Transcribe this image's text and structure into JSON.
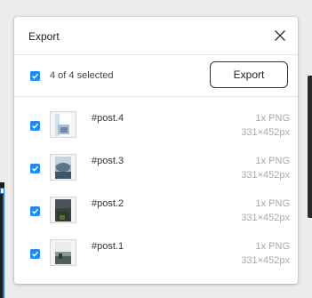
{
  "dialog": {
    "title": "Export",
    "close_icon": "close-icon"
  },
  "selection": {
    "label": "4 of 4 selected",
    "checked": true,
    "export_label": "Export"
  },
  "items": [
    {
      "name": "#post.4",
      "format": "1x PNG",
      "size": "331×452px",
      "checked": true
    },
    {
      "name": "#post.3",
      "format": "1x PNG",
      "size": "331×452px",
      "checked": true
    },
    {
      "name": "#post.2",
      "format": "1x PNG",
      "size": "331×452px",
      "checked": true
    },
    {
      "name": "#post.1",
      "format": "1x PNG",
      "size": "331×452px",
      "checked": true
    }
  ],
  "colors": {
    "accent": "#1a8cff",
    "muted_text": "#aaaaaa"
  }
}
